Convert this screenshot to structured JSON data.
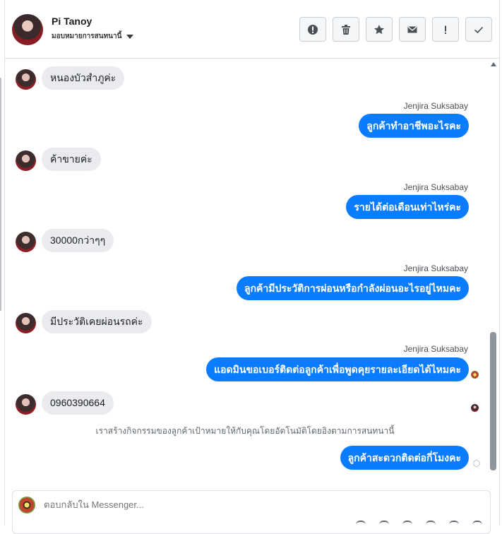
{
  "header": {
    "name": "Pi Tanoy",
    "subtitle": "มอบหมายการสนทนานี้",
    "toolbar": [
      {
        "icon": "alert-circle-icon",
        "name": "mark-spam-button"
      },
      {
        "icon": "trash-icon",
        "name": "delete-button"
      },
      {
        "icon": "star-icon",
        "name": "star-button"
      },
      {
        "icon": "envelope-icon",
        "name": "mark-unread-button"
      },
      {
        "icon": "exclamation-icon",
        "name": "follow-up-button"
      },
      {
        "icon": "check-icon",
        "name": "mark-done-button"
      }
    ]
  },
  "messages": [
    {
      "dir": "in",
      "text": "หนองบัวสำภูค่ะ"
    },
    {
      "dir": "out",
      "sender": "Jenjira Suksabay",
      "text": "ลูกค้าทำอาชีพอะไรคะ"
    },
    {
      "dir": "in",
      "text": "ค้าขายค่ะ"
    },
    {
      "dir": "out",
      "sender": "Jenjira Suksabay",
      "text": "รายได้ต่อเดือนเท่าไหร่คะ"
    },
    {
      "dir": "in",
      "text": "30000กว่าๆๆ"
    },
    {
      "dir": "out",
      "sender": "Jenjira Suksabay",
      "text": "ลูกค้ามีประวัติการผ่อนหรือกำลังผ่อนอะไรอยู่ไหมคะ"
    },
    {
      "dir": "in",
      "text": "มีประวัติเคยผ่อนรถค่ะ"
    },
    {
      "dir": "out",
      "sender": "Jenjira Suksabay",
      "text": "แอดมินขอเบอร์ติดต่อลูกค้าเพื่อพูดคุยรายละเอียดได้ไหมคะ"
    },
    {
      "dir": "in",
      "text": "0960390664"
    },
    {
      "dir": "system",
      "text": "เราสร้างกิจกรรมของลูกค้าเป้าหมายให้กับคุณโดยอัตโนมัติโดยอิงตามการสนทนานี้"
    },
    {
      "dir": "out",
      "text": "ลูกค้าสะดวกติดต่อกี่โมงคะ"
    }
  ],
  "composer": {
    "placeholder": "ตอบกลับใน Messenger..."
  },
  "colors": {
    "outgoing_bubble": "#0a7cff",
    "incoming_bubble": "#e9ebee"
  }
}
